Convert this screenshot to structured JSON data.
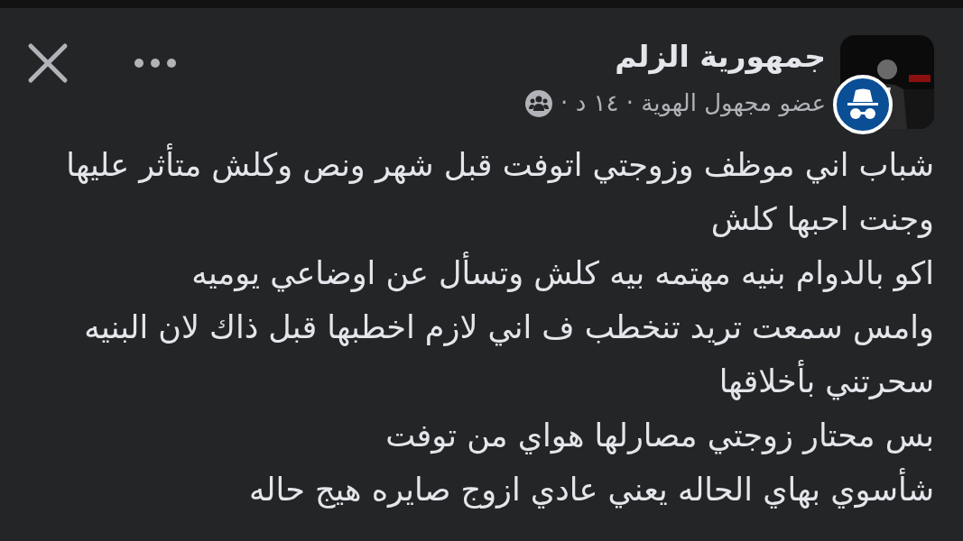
{
  "header": {
    "group_name": "جمهورية الزلم",
    "meta": "عضو مجهول الهوية · ١٤ د ·",
    "anonymous": true
  },
  "post": {
    "lines": [
      "شباب اني موظف وزوجتي اتوفت قبل شهر ونص وكلش متأثر عليها",
      "وجنت احبها كلش",
      "اكو بالدوام بنيه مهتمه بيه كلش وتسأل عن اوضاعي يوميه",
      "وامس سمعت تريد تنخطب ف اني لازم اخطبها قبل ذاك لان البنيه",
      "سحرتني بأخلاقها",
      "بس محتار زوجتي مصارلها هواي من توفت",
      "شأسوي بهاي الحاله يعني عادي ازوج صايره هيج حاله"
    ]
  }
}
